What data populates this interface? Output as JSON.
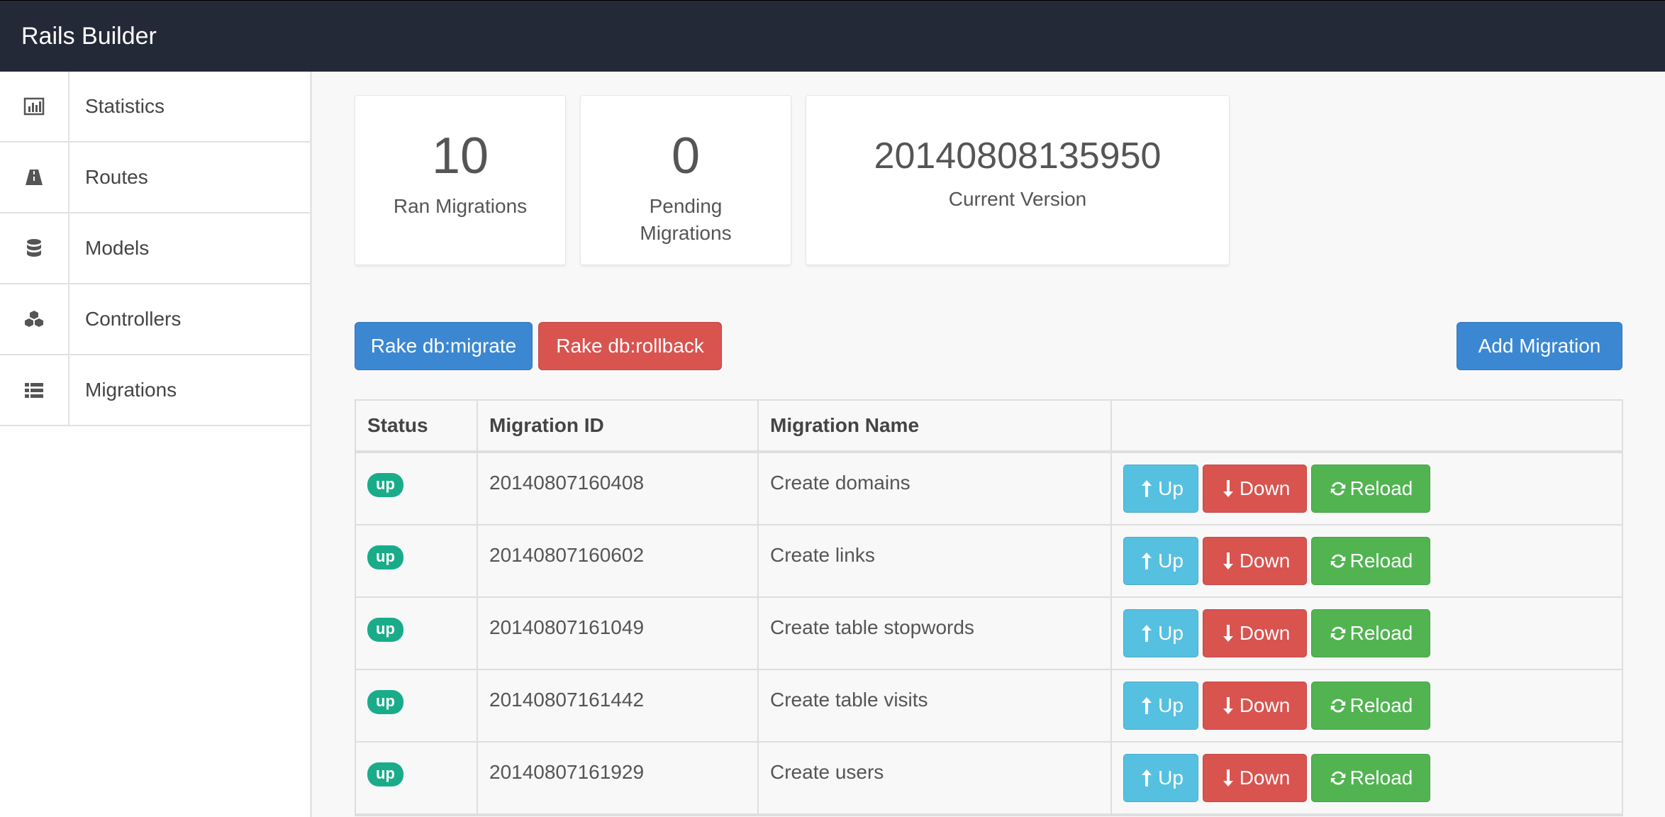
{
  "app": {
    "title": "Rails Builder"
  },
  "sidebar": {
    "items": [
      {
        "label": "Statistics",
        "icon": "bar-chart-icon"
      },
      {
        "label": "Routes",
        "icon": "road-icon"
      },
      {
        "label": "Models",
        "icon": "database-icon"
      },
      {
        "label": "Controllers",
        "icon": "cubes-icon"
      },
      {
        "label": "Migrations",
        "icon": "list-icon"
      }
    ]
  },
  "stats": {
    "ran": {
      "value": "10",
      "label": "Ran Migrations"
    },
    "pending": {
      "value": "0",
      "label": "Pending Migrations"
    },
    "version": {
      "value": "20140808135950",
      "label": "Current Version"
    }
  },
  "toolbar": {
    "migrate_label": "Rake db:migrate",
    "rollback_label": "Rake db:rollback",
    "add_label": "Add Migration"
  },
  "table": {
    "headers": [
      "Status",
      "Migration ID",
      "Migration Name",
      ""
    ],
    "rows": [
      {
        "status": "up",
        "id": "20140807160408",
        "name": "Create domains"
      },
      {
        "status": "up",
        "id": "20140807160602",
        "name": "Create links"
      },
      {
        "status": "up",
        "id": "20140807161049",
        "name": "Create table stopwords"
      },
      {
        "status": "up",
        "id": "20140807161442",
        "name": "Create table visits"
      },
      {
        "status": "up",
        "id": "20140807161929",
        "name": "Create users"
      }
    ],
    "actions": {
      "up": "Up",
      "down": "Down",
      "reload": "Reload"
    }
  },
  "colors": {
    "navbar": "#242938",
    "primary": "#3b87d2",
    "danger": "#d9534f",
    "info": "#56c0e0",
    "success": "#51b451",
    "badge": "#1aac8a"
  }
}
